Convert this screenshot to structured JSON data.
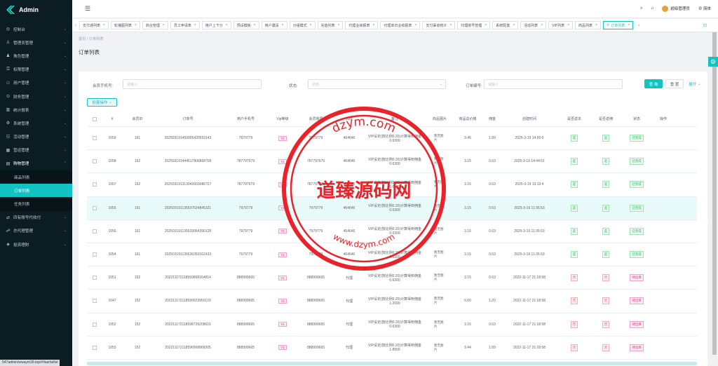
{
  "app": {
    "title": "Admin"
  },
  "header": {
    "user_name": "超级管理员",
    "language": "简体"
  },
  "sidebar": {
    "items": [
      {
        "icon": "dashboard-icon",
        "label": "控制台",
        "chevron": false
      },
      {
        "icon": "user-icon",
        "label": "管理员管理",
        "chevron": false
      },
      {
        "icon": "role-icon",
        "label": "角色管理",
        "chevron": false
      },
      {
        "icon": "permission-icon",
        "label": "权限管理",
        "chevron": false
      },
      {
        "icon": "users-icon",
        "label": "用户管理",
        "chevron": true
      },
      {
        "icon": "finance-icon",
        "label": "财务管理",
        "chevron": true
      },
      {
        "icon": "stats-icon",
        "label": "统计报表",
        "chevron": true
      },
      {
        "icon": "system-icon",
        "label": "系统管理",
        "chevron": true
      },
      {
        "icon": "activity-icon",
        "label": "活动管理",
        "chevron": true
      },
      {
        "icon": "site-icon",
        "label": "营运管理",
        "chevron": true
      }
    ],
    "open_group": {
      "icon": "cart-icon",
      "label": "购物管理"
    },
    "sub_items": [
      {
        "label": "商品列表",
        "active": false
      },
      {
        "label": "订单列表",
        "active": true
      },
      {
        "label": "任务列表",
        "active": false
      }
    ],
    "bottom_items": [
      {
        "icon": "collect-icon",
        "label": "四有账号代收付",
        "chevron": true
      },
      {
        "icon": "agent-icon",
        "label": "总代理管理",
        "chevron": true
      },
      {
        "icon": "invest-icon",
        "label": "投资理财",
        "chevron": true
      }
    ]
  },
  "tabs": [
    {
      "label": "支付通列表",
      "active": false
    },
    {
      "label": "轮播图列表",
      "active": false
    },
    {
      "label": "商合管理",
      "active": false
    },
    {
      "label": "员工申请表",
      "active": false
    },
    {
      "label": "用户上下分",
      "active": false
    },
    {
      "label": "预设模板",
      "active": false
    },
    {
      "label": "用户邀请",
      "active": false
    },
    {
      "label": "分组模式",
      "active": false
    },
    {
      "label": "充值列表",
      "active": false
    },
    {
      "label": "代理业绩报表",
      "active": false
    },
    {
      "label": "代理单日业绩报表",
      "active": false
    },
    {
      "label": "支付渠道统计",
      "active": false
    },
    {
      "label": "代理账号管理",
      "active": false
    },
    {
      "label": "系统配置",
      "active": false
    },
    {
      "label": "活动列表",
      "active": false
    },
    {
      "label": "VIP列表",
      "active": false
    },
    {
      "label": "商品列表",
      "active": false
    },
    {
      "label": "订单列表",
      "active": true
    }
  ],
  "breadcrumb": {
    "home": "首页",
    "sep": "/",
    "current": "订单列表"
  },
  "page": {
    "title": "订单列表"
  },
  "filters": {
    "phone_label": "会员手机号:",
    "phone_placeholder": "请输入",
    "status_label": "状态:",
    "status_placeholder": "状态",
    "order_label": "订单编号:",
    "order_placeholder": "请输入",
    "search": "查 询",
    "reset": "重 置",
    "expand": "展开"
  },
  "toolbar": {
    "batch": "批量操作"
  },
  "table": {
    "columns": [
      "#",
      "会员ID",
      "订单号",
      "用户手机号",
      "Vip等级",
      "会员账号",
      "代理",
      "备注",
      "商品图片",
      "商品总价格",
      "佣金",
      "创建时间",
      "是否返本",
      "是否返佣",
      "状态",
      "操作"
    ],
    "rows": [
      {
        "id": "1059",
        "member_id": "161",
        "order_no": "2025031914500054205531​43",
        "phone": "7979779",
        "vip": "V1",
        "account": "7979779",
        "agent": "464646",
        "remark": "VIP设定(按比例0.20)计算得到佣金0.6300",
        "img": "暂无图片",
        "total": "9.45",
        "commission": "1.89",
        "time": "2025-3-19 14:50:0",
        "refund": "是",
        "rebate": "是",
        "status": "已完成"
      },
      {
        "id": "1058",
        "member_id": "162",
        "order_no": "20250319144451780686870​9",
        "phone": "787797979",
        "vip": "V1",
        "account": "787797979",
        "agent": "464646",
        "remark": "VIP设定(按比例0.20)计算得到佣金0.6300",
        "img": "暂无图片",
        "total": "3.15",
        "commission": "0.63",
        "time": "2025-3-19 14:44:51",
        "refund": "是",
        "rebate": "是",
        "status": "已完成"
      },
      {
        "id": "1057",
        "member_id": "162",
        "order_no": "2025031913130435030867​27",
        "phone": "787797979",
        "vip": "V1",
        "account": "787797979",
        "agent": "464646",
        "remark": "VIP设定(按比例0.20)计算得到佣金0.6300",
        "img": "暂无图片",
        "total": "3.15",
        "commission": "0.63",
        "time": "2025-3-19 13:13:4",
        "refund": "是",
        "rebate": "是",
        "status": "已完成"
      },
      {
        "id": "1055",
        "member_id": "161",
        "order_no": "2025031911355376248453​21",
        "phone": "7979779",
        "vip": "V1",
        "account": "7979779",
        "agent": "464646",
        "remark": "VIP设定(按比例0.20)计算得到佣金0.6300",
        "img": "暂无图片",
        "total": "3.15",
        "commission": "0.63",
        "time": "2025-3-19 11:35:53",
        "refund": "是",
        "rebate": "是",
        "status": "已完成"
      },
      {
        "id": "1056",
        "member_id": "161",
        "order_no": "2025031911355339543901​28",
        "phone": "7979779",
        "vip": "V1",
        "account": "7979779",
        "agent": "464646",
        "remark": "VIP设定(按比例0.20)计算得到佣金0.6300",
        "img": "暂无图片",
        "total": "3.15",
        "commission": "0.63",
        "time": "2025-3-19 11:35:53",
        "refund": "是",
        "rebate": "是",
        "status": "已完成"
      },
      {
        "id": "1054",
        "member_id": "161",
        "order_no": "2025031911355363501624​33",
        "phone": "7979779",
        "vip": "V1",
        "account": "7979779",
        "agent": "464646",
        "remark": "VIP设定(按比例0.20)计算得到佣金0.6300",
        "img": "暂无图片",
        "total": "3.15",
        "commission": "0.63",
        "time": "2025-3-19 11:35:53",
        "refund": "是",
        "rebate": "是",
        "status": "已完成"
      },
      {
        "id": "1051",
        "member_id": "152",
        "order_no": "2022111721185938681648​14",
        "phone": "888999665",
        "vip": "V1",
        "account": "888999665",
        "agent": "代理",
        "remark": "VIP设定(按比例0.20)计算得到佣金0.6300",
        "img": "暂无图片",
        "total": "3.15",
        "commission": "0.63",
        "time": "2022-11-17 21:18:58",
        "refund": "否",
        "rebate": "否",
        "status": "待出库"
      },
      {
        "id": "1047",
        "member_id": "152",
        "order_no": "2022111721185990239501​29",
        "phone": "888999665",
        "vip": "V1",
        "account": "888999665",
        "agent": "代理",
        "remark": "VIP设定(按比例0.20)计算得到佣金1.2000",
        "img": "暂无图片",
        "total": "6.00",
        "commission": "1.20",
        "time": "2022-11-17 21:18:58",
        "refund": "否",
        "rebate": "否",
        "status": "待出库"
      },
      {
        "id": "1052",
        "member_id": "152",
        "order_no": "2022111721185987292086​16",
        "phone": "888999665",
        "vip": "V1",
        "account": "888999665",
        "agent": "代理",
        "remark": "VIP设定(按比例0.20)计算得到佣金0.6300",
        "img": "暂无图片",
        "total": "3.15",
        "commission": "0.63",
        "time": "2022-11-17 21:18:58",
        "refund": "否",
        "rebate": "否",
        "status": "待出库"
      },
      {
        "id": "1053",
        "member_id": "152",
        "order_no": "2022111721185969688682​05",
        "phone": "888999665",
        "vip": "V1",
        "account": "888999665",
        "agent": "代理",
        "remark": "VIP设定(按比例0.20)计算得到佣金1.8900",
        "img": "暂无图片",
        "total": "9.44",
        "commission": "1.89",
        "time": "2022-11-17 21:18:58",
        "refund": "否",
        "rebate": "否",
        "status": "待出库"
      }
    ]
  },
  "status_url": "547admin/wwaym18.top/#/tasrfa/list",
  "watermark": {
    "main": "道臻源码网",
    "domain_top": "dzym.com",
    "domain_bottom": "www.dzym.com",
    "color": "#e8232a"
  },
  "colors": {
    "accent": "#13c2c2",
    "sidebar_bg": "#0b1d22"
  }
}
